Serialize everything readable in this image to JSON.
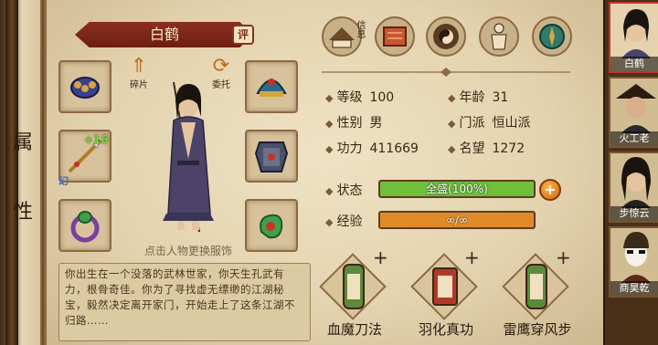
{
  "left_scroll": {
    "chars": [
      "属",
      "性"
    ]
  },
  "character": {
    "name": "白鹤",
    "eval_badge": "评",
    "plus_label": "+15",
    "slot_tag": "幻",
    "fragment_label": "碎片",
    "entrust_label": "委托",
    "hint": "点击人物更换服饰",
    "bio": "你出生在一个没落的武林世家，你天生孔武有力，根骨奇佳。你为了寻找虚无缥缈的江湖秘宝，毅然决定离开家门，开始走上了这条江湖不归路……"
  },
  "top_icons": [
    {
      "icon": "hat-letter-icon",
      "label": "信息"
    },
    {
      "icon": "scroll-book-icon",
      "label": ""
    },
    {
      "icon": "bagua-icon",
      "label": ""
    },
    {
      "icon": "body-meridian-icon",
      "label": ""
    },
    {
      "icon": "compass-icon",
      "label": ""
    }
  ],
  "stats": {
    "level_label": "等级",
    "level": "100",
    "age_label": "年龄",
    "age": "31",
    "gender_label": "性别",
    "gender": "男",
    "sect_label": "门派",
    "sect": "恒山派",
    "power_label": "功力",
    "power": "411669",
    "fame_label": "名望",
    "fame": "1272"
  },
  "status": {
    "label": "状态",
    "text": "全盛(100%)",
    "fraction": 1.0,
    "color": "#6fbf3a"
  },
  "exp": {
    "label": "经验",
    "text": "∞/∞",
    "fraction": 1.0,
    "color": "#e08a2a"
  },
  "add_label": "+",
  "skills": [
    {
      "name": "血魔刀法",
      "plus": "+",
      "color": "#5c8a3a"
    },
    {
      "name": "羽化真功",
      "plus": "+",
      "color": "#b03a2a"
    },
    {
      "name": "雷鹰穿风步",
      "plus": "+",
      "color": "#5c8a3a"
    }
  ],
  "roster": [
    {
      "name": "白鹤",
      "active": true
    },
    {
      "name": "火工老",
      "active": false
    },
    {
      "name": "步惊云",
      "active": false
    },
    {
      "name": "商昊乾",
      "active": false
    }
  ]
}
